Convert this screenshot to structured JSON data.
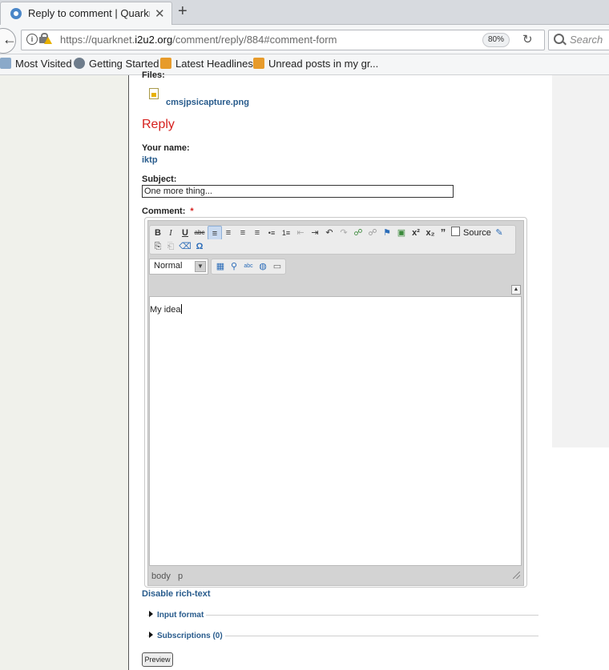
{
  "browser": {
    "tab_title": "Reply to comment | Quarknet",
    "new_tab_label": "+",
    "url_prefix": "https://quarknet.",
    "url_domain": "i2u2.org",
    "url_path": "/comment/reply/884#comment-form",
    "zoom": "80%",
    "search_placeholder": "Search",
    "bookmarks": [
      "Most Visited",
      "Getting Started",
      "Latest Headlines",
      "Unread posts in my gr..."
    ]
  },
  "page": {
    "files_label": "Files:",
    "file_name": "cmsjpsicapture.png",
    "reply_heading": "Reply",
    "name_label": "Your name:",
    "name_value": "iktp",
    "subject_label": "Subject:",
    "subject_value": "One more thing...",
    "comment_label": "Comment:",
    "required_mark": "*",
    "editor": {
      "source_label": "Source",
      "format_value": "Normal",
      "body_text": "My idea",
      "path_bar": "body   p",
      "toolbar_row1": [
        "B",
        "I",
        "U",
        "abc",
        "≡",
        "≡",
        "≡",
        "≡",
        "•≡",
        "1≡",
        "⇤",
        "⇥",
        "↶",
        "↷",
        "☍",
        "☍",
        "⚑",
        "▣",
        "x²",
        "x₂",
        "”"
      ],
      "toolbar_row2": [
        "⎘",
        "⎗",
        "⌫",
        "Ω"
      ],
      "toolbar_row3": [
        "▦",
        "⚲",
        "abc",
        "◍",
        "▭"
      ]
    },
    "disable_rich_text": "Disable rich-text",
    "input_format": "Input format",
    "subscriptions": "Subscriptions (0)",
    "preview_button": "Preview"
  },
  "colors": {
    "link": "#285b8c",
    "heading_red": "#d6201e"
  }
}
